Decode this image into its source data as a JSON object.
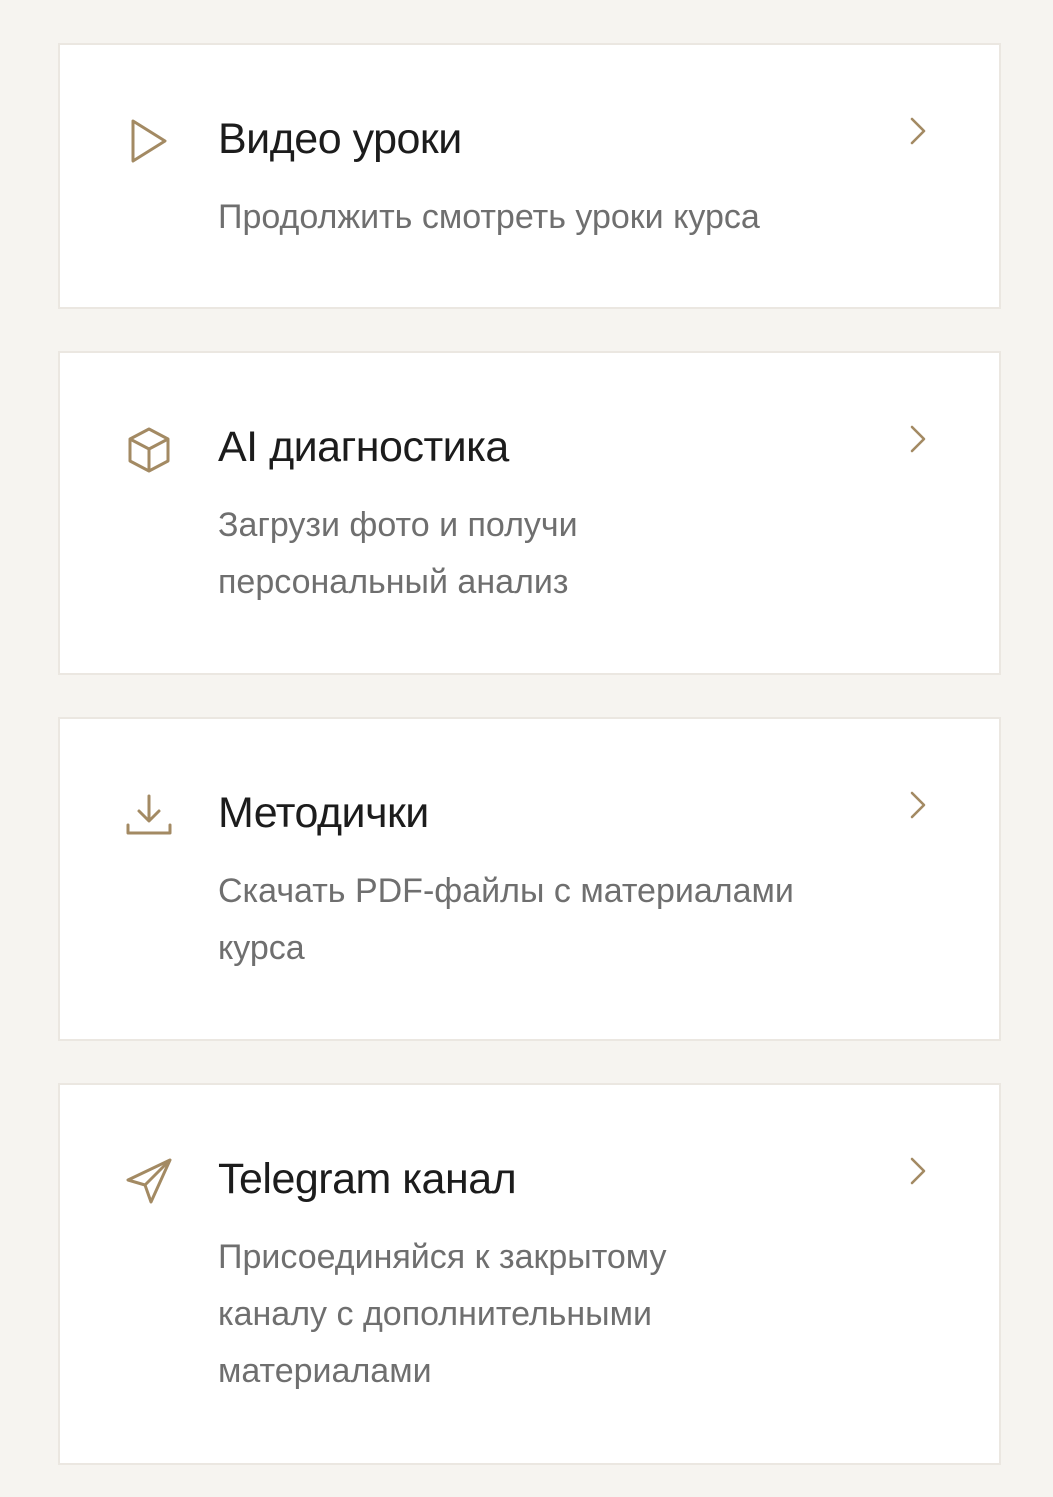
{
  "colors": {
    "background": "#f6f4f0",
    "card": "#ffffff",
    "card_border": "#ebe7e1",
    "accent": "#a38a63",
    "title": "#1c1c1c",
    "description": "#6f6f6f"
  },
  "cards": [
    {
      "icon": "play-icon",
      "title": "Видео уроки",
      "description": "Продолжить смотреть уроки курса"
    },
    {
      "icon": "cube-icon",
      "title": "AI диагностика",
      "description": "Загрузи фото и получи персональный анализ"
    },
    {
      "icon": "download-icon",
      "title": "Методички",
      "description": "Скачать PDF-файлы с материалами курса"
    },
    {
      "icon": "send-icon",
      "title": "Telegram канал",
      "description": "Присоединяйся к закрытому каналу с дополнительными материалами"
    }
  ]
}
